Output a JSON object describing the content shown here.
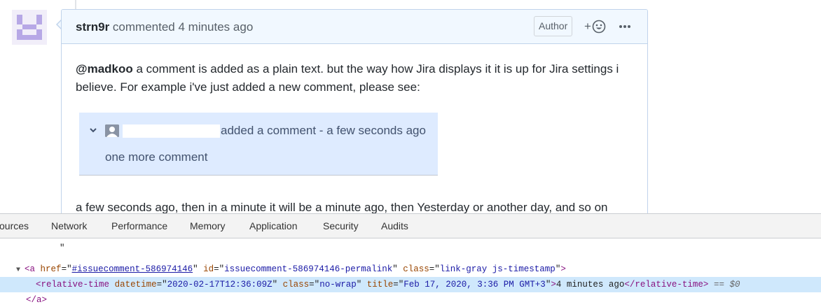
{
  "comment": {
    "author": "strn9r",
    "action": "commented",
    "time": "4 minutes ago",
    "author_badge": "Author",
    "reaction_plus": "+",
    "body": {
      "mention": "@madkoo",
      "line1_rest": " a comment is added as a plain text. but the way how Jira displays it it is up for Jira settings i",
      "line2": "believe. For example i've just added a new comment, please see:",
      "line3": "a few seconds ago, then in a minute it will be a minute ago, then Yesterday or another day, and so on"
    },
    "jira_screenshot": {
      "added_text": "added a comment - a few seconds ago",
      "comment_text": "one more comment"
    }
  },
  "devtools": {
    "tabs": [
      "ources",
      "Network",
      "Performance",
      "Memory",
      "Application",
      "Security",
      "Audits"
    ],
    "code": {
      "quote_line": "\"",
      "anchor_tag": "a",
      "href_attr": "href",
      "href_val": "#issuecomment-586974146",
      "id_attr": "id",
      "id_val": "issuecomment-586974146-permalink",
      "class_attr": "class",
      "class_val": "link-gray js-timestamp",
      "rt_tag": "relative-time",
      "datetime_attr": "datetime",
      "datetime_val": "2020-02-17T12:36:09Z",
      "rt_class_val": "no-wrap",
      "title_attr": "title",
      "title_val": "Feb 17, 2020, 3:36 PM GMT+3",
      "rt_text": "4 minutes ago",
      "selected_marker": "== $0",
      "close_a": "</a>"
    }
  },
  "colors": {
    "header_bg": "#f1f8ff",
    "header_border": "#c0d3eb",
    "jira_bg": "#deebff",
    "devtools_selected": "#cfe8fc",
    "avatar_purple": "#b7a8e6"
  },
  "icons": [
    "identicon-avatar",
    "smiley-icon",
    "kebab-icon",
    "chevron-down-icon",
    "user-icon",
    "expand-triangle-icon"
  ]
}
